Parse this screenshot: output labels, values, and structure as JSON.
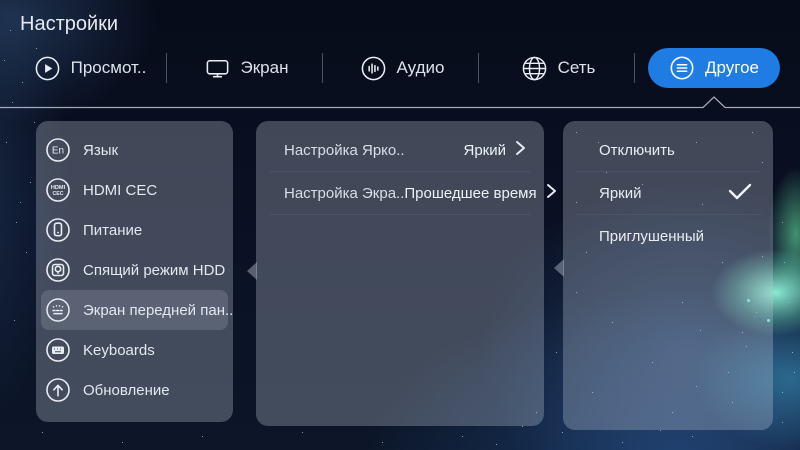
{
  "page": {
    "title": "Настройки"
  },
  "tabs": [
    {
      "label": "Просмот..",
      "icon": "play-icon",
      "selected": false
    },
    {
      "label": "Экран",
      "icon": "screen-icon",
      "selected": false
    },
    {
      "label": "Аудио",
      "icon": "audio-icon",
      "selected": false
    },
    {
      "label": "Сеть",
      "icon": "network-icon",
      "selected": false
    },
    {
      "label": "Другое",
      "icon": "menu-icon",
      "selected": true
    }
  ],
  "sidebar": {
    "items": [
      {
        "label": "Язык",
        "icon": "language-icon",
        "selected": false
      },
      {
        "label": "HDMI CEC",
        "icon": "hdmi-cec-icon",
        "selected": false
      },
      {
        "label": "Питание",
        "icon": "power-icon",
        "selected": false
      },
      {
        "label": "Спящий режим HDD",
        "icon": "hdd-sleep-icon",
        "selected": false
      },
      {
        "label": "Экран передней пан..",
        "icon": "front-panel-icon",
        "selected": true
      },
      {
        "label": "Keyboards",
        "icon": "keyboard-icon",
        "selected": false
      },
      {
        "label": "Обновление",
        "icon": "update-icon",
        "selected": false
      }
    ]
  },
  "settings_panel": {
    "rows": [
      {
        "label": "Настройка Ярко..",
        "value": "Яркий"
      },
      {
        "label": "Настройка Экра..",
        "value": "Прошедшее время"
      }
    ]
  },
  "options_panel": {
    "options": [
      {
        "label": "Отключить",
        "selected": false
      },
      {
        "label": "Яркий",
        "selected": true
      },
      {
        "label": "Приглушенный",
        "selected": false
      }
    ]
  },
  "icon_text": {
    "language": "En",
    "hdmi_line1": "HDMI",
    "hdmi_line2": "CEC"
  },
  "colors": {
    "accent": "#1e7ce2",
    "panel": "rgba(196,204,218,0.30)",
    "text": "#e6eaf0",
    "background": "#0a1124"
  }
}
